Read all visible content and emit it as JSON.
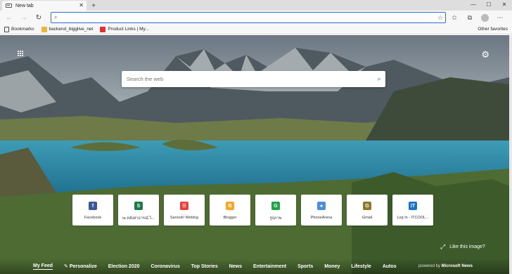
{
  "tab": {
    "title": "New tab",
    "close": "✕"
  },
  "new_tab_button": "+",
  "window_controls": [
    "—",
    "☐",
    "✕"
  ],
  "nav": {
    "back": "←",
    "forward": "→",
    "refresh": "↻"
  },
  "address_bar": {
    "value": "",
    "placeholder": ""
  },
  "favorites": [
    {
      "label": "Bookmarks",
      "icon": "bookmarks-icon"
    },
    {
      "label": "backend_bigglive_net",
      "icon": "folder-icon"
    },
    {
      "label": "Product Links | My...",
      "icon": "product-links-icon"
    }
  ],
  "other_favorites": "Other favorites",
  "search": {
    "placeholder": "Search the web"
  },
  "tiles": [
    {
      "label": "Facebook",
      "letter": "f",
      "color": "#3b5998"
    },
    {
      "label": "ta คลังสาธารณ์ ไ...",
      "letter": "S",
      "color": "#1f7a4a"
    },
    {
      "label": "Sanook! Weblog",
      "letter": "☰",
      "color": "#e8413c"
    },
    {
      "label": "Blogger",
      "letter": "B",
      "color": "#f5a623"
    },
    {
      "label": "รูปภาพ",
      "letter": "G",
      "color": "#22a146"
    },
    {
      "label": "PhoneArena",
      "letter": "●",
      "color": "#4a90d9"
    },
    {
      "label": "Gmail",
      "letter": "G",
      "color": "#8a7a2e"
    },
    {
      "label": "Log In - ITCOOL...",
      "letter": "iT",
      "color": "#1a73c8"
    }
  ],
  "like_image": "Like this image?",
  "feed_nav": [
    "My Feed",
    "Personalize",
    "Election 2020",
    "Coronavirus",
    "Top Stories",
    "News",
    "Entertainment",
    "Sports",
    "Money",
    "Lifestyle",
    "Autos"
  ],
  "powered_by": {
    "prefix": "powered by",
    "brand": "Microsoft News"
  }
}
